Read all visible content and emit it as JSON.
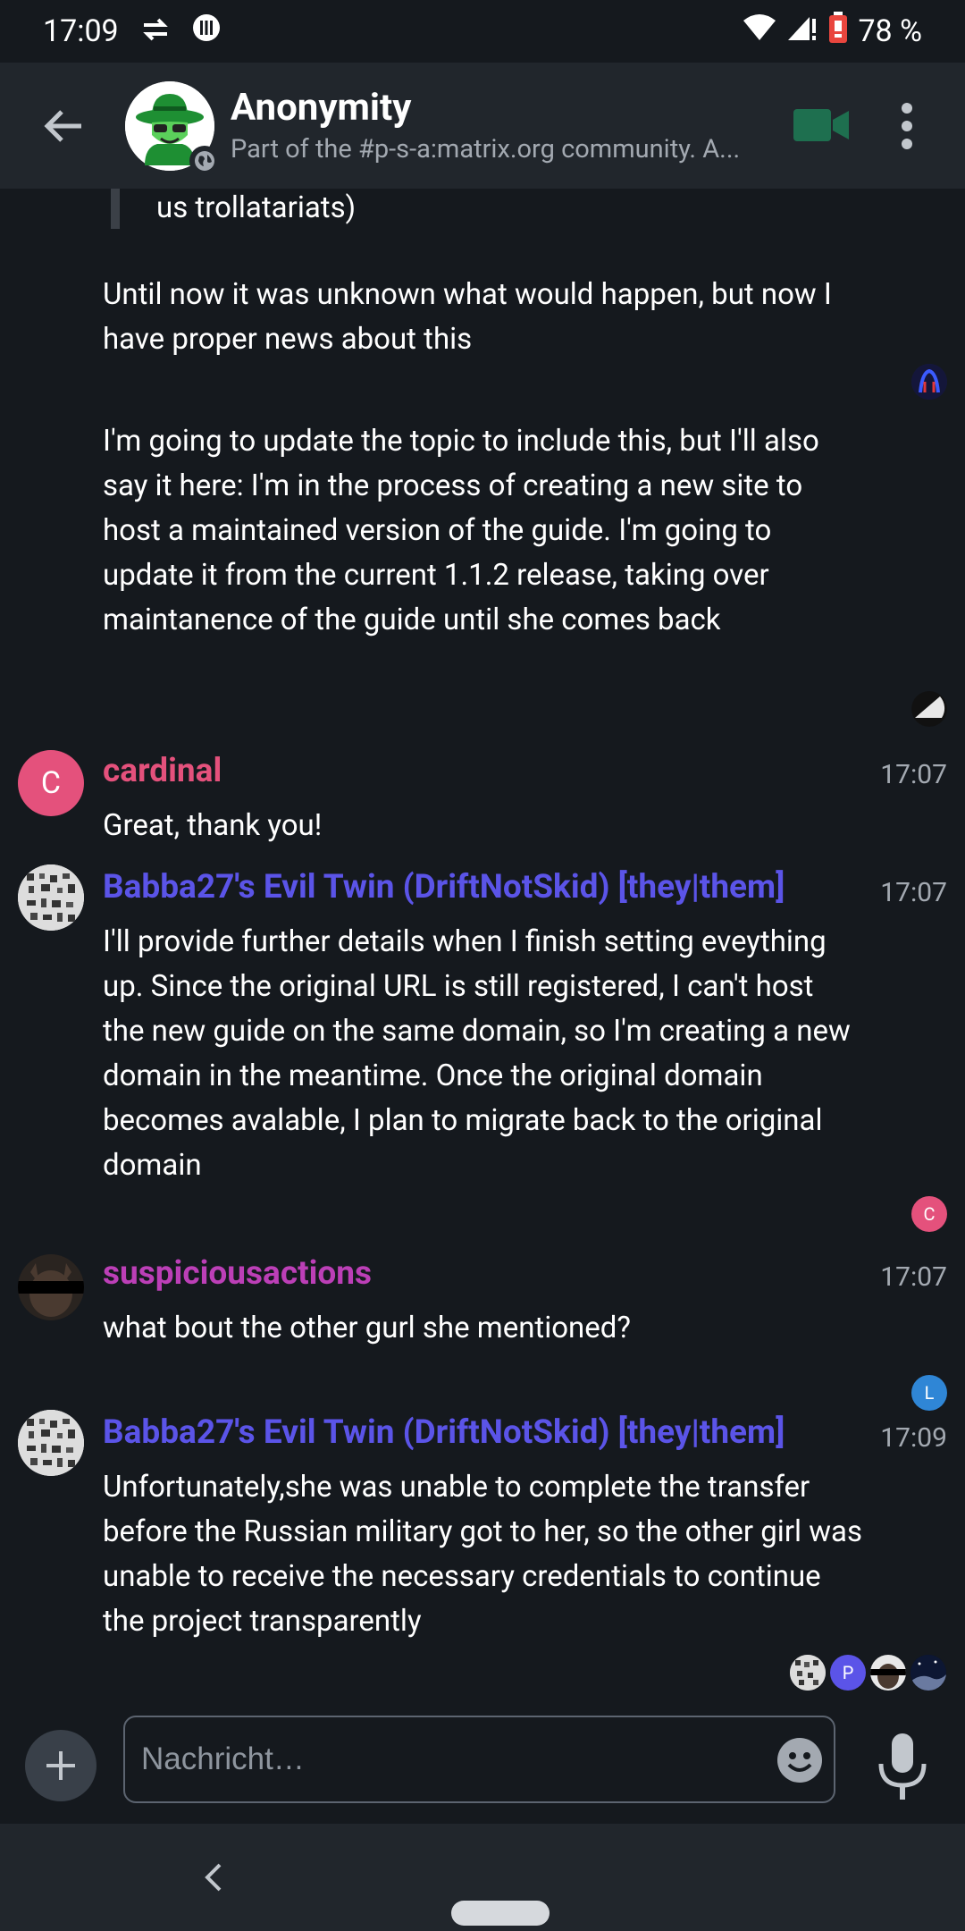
{
  "status_bar": {
    "time": "17:09",
    "battery": "78 %"
  },
  "header": {
    "room_name": "Anonymity",
    "room_topic": "Part of the #p-s-a:matrix.org community. A..."
  },
  "messages": [
    {
      "text": "us trollatariats)"
    },
    {
      "text": "Until now it was unknown what would happen, but now I have proper news about this"
    },
    {
      "text": "I'm going to update the topic to include this, but I'll also say it here: I'm in the process of creating a new site to host a maintained version of the guide. I'm going to update it from the current 1.1.2 release, taking over maintanence of the guide until she comes back"
    },
    {
      "sender": "cardinal",
      "avatar_letter": "C",
      "time": "17:07",
      "text": "Great, thank you!"
    },
    {
      "sender": "Babba27's Evil Twin (DriftNotSkid) [they|them]",
      "time": "17:07",
      "text": "I'll provide further details when I finish setting eveything up. Since the original URL is still registered, I can't host the new guide on the same domain, so I'm creating a new domain in the meantime. Once the original domain becomes avalable, I plan to migrate back to the original domain"
    },
    {
      "sender": "suspiciousactions",
      "time": "17:07",
      "text": "what bout the other gurl she mentioned?"
    },
    {
      "sender": "Babba27's Evil Twin (DriftNotSkid) [they|them]",
      "time": "17:09",
      "text": "Unfortunately,she was unable to complete the transfer before the Russian military got to her, so the other girl was unable to receive the necessary credentials to continue the project transparently"
    }
  ],
  "read_receipts": {
    "c": "C",
    "l": "L",
    "p": "P"
  },
  "composer": {
    "placeholder": "Nachricht…"
  },
  "colors": {
    "cardinal": "#e4517c",
    "babba": "#5b54e8",
    "suspicious": "#bc3fb7",
    "background": "#15191e",
    "bar": "#21262c"
  }
}
